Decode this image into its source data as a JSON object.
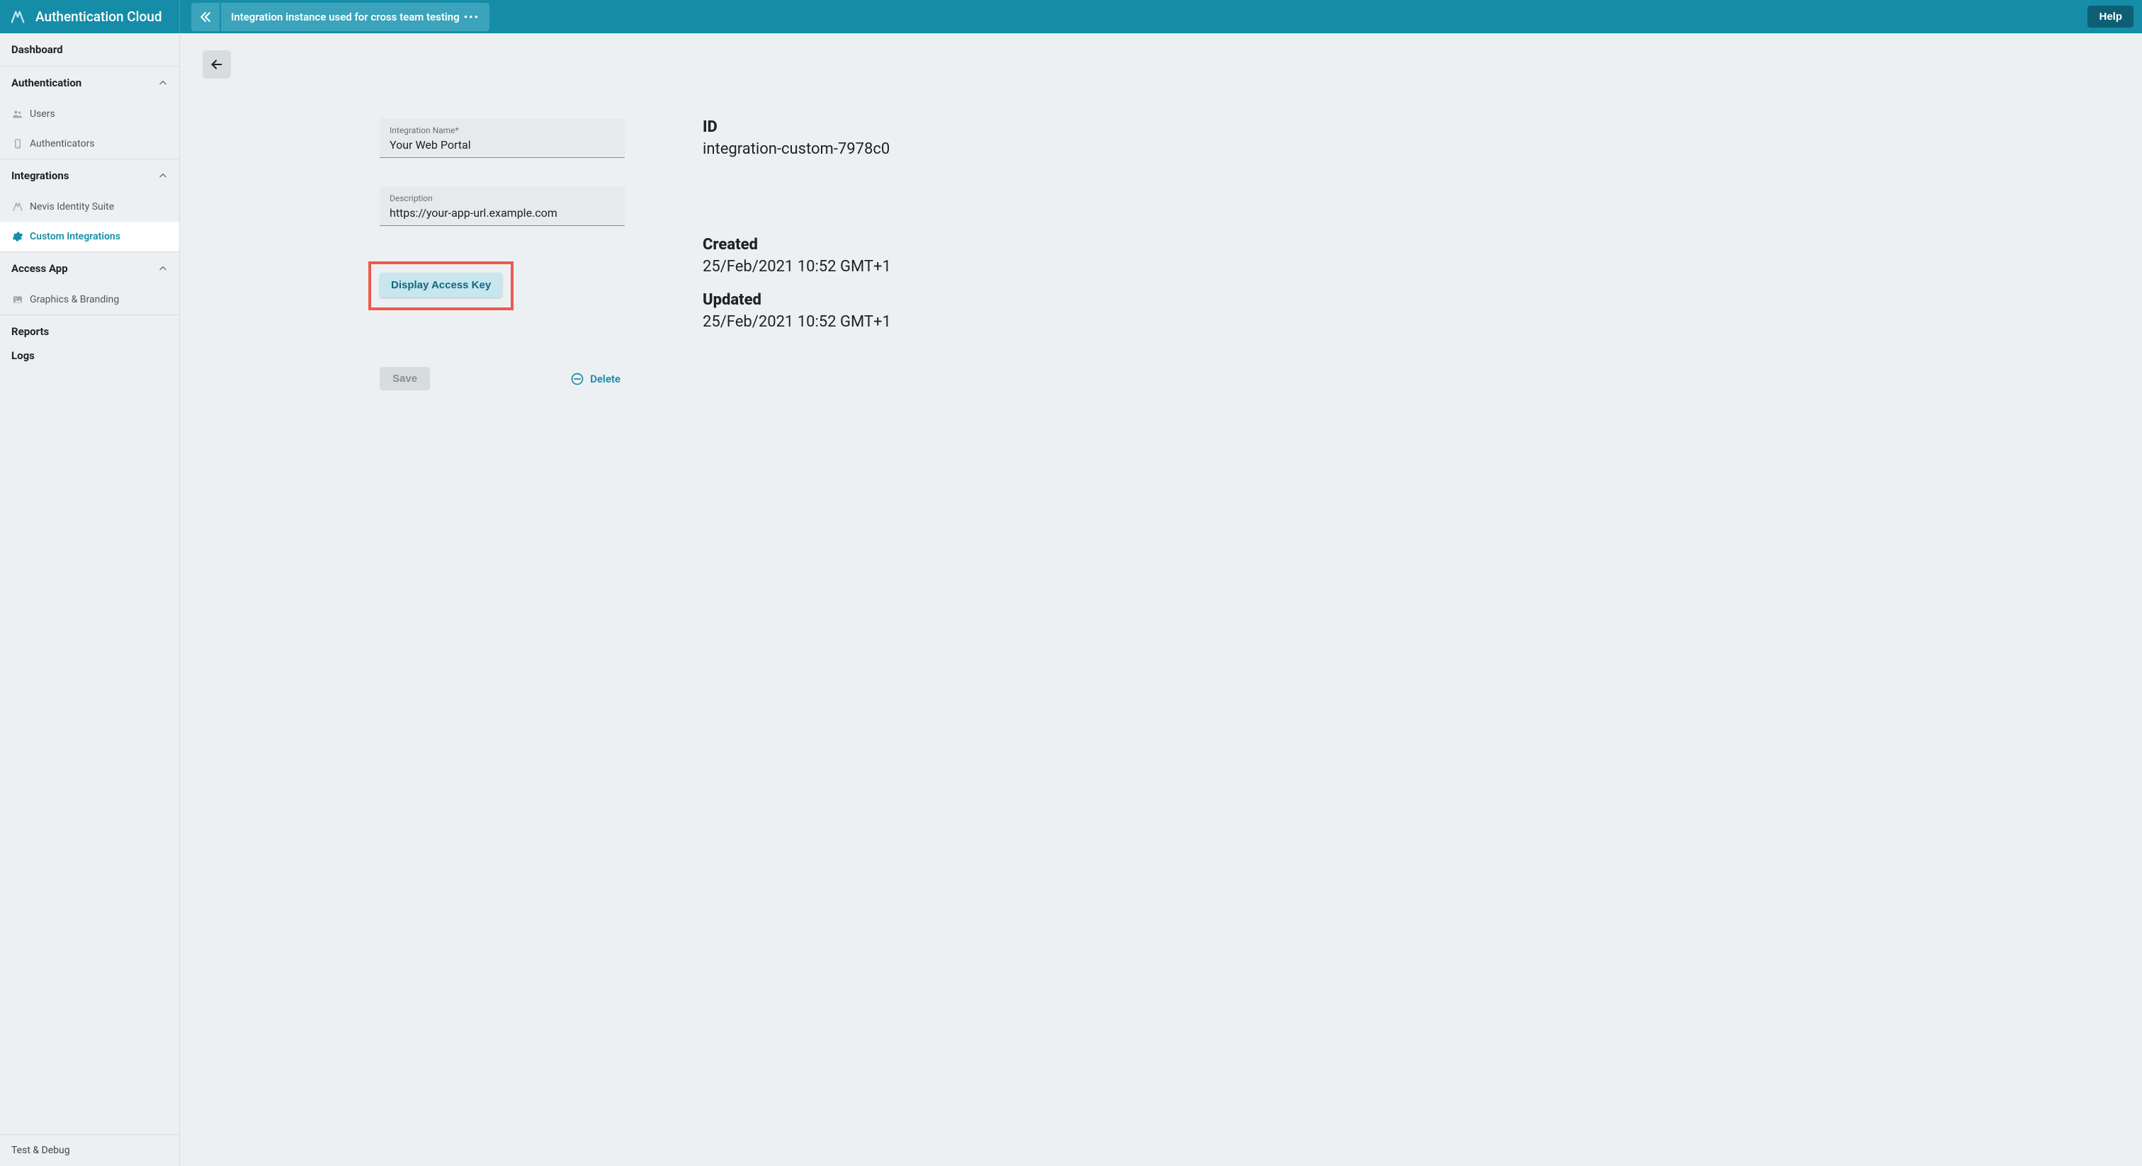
{
  "header": {
    "brand_title": "Authentication Cloud",
    "breadcrumb_label": "Integration instance used for cross team testing",
    "breadcrumb_dots": "•••",
    "help_label": "Help"
  },
  "sidebar": {
    "dashboard": "Dashboard",
    "sections": {
      "authentication": {
        "label": "Authentication",
        "items": [
          {
            "label": "Users"
          },
          {
            "label": "Authenticators"
          }
        ]
      },
      "integrations": {
        "label": "Integrations",
        "items": [
          {
            "label": "Nevis Identity Suite"
          },
          {
            "label": "Custom Integrations",
            "active": true
          }
        ]
      },
      "access_app": {
        "label": "Access App",
        "items": [
          {
            "label": "Graphics & Branding"
          }
        ]
      }
    },
    "reports": "Reports",
    "logs": "Logs",
    "test_debug": "Test & Debug"
  },
  "form": {
    "name_label": "Integration Name*",
    "name_value": "Your Web Portal",
    "description_label": "Description",
    "description_value": "https://your-app-url.example.com",
    "display_access_key_label": "Display Access Key",
    "save_label": "Save",
    "delete_label": "Delete"
  },
  "meta": {
    "id_label": "ID",
    "id_value": "integration-custom-7978c0",
    "created_label": "Created",
    "created_value": "25/Feb/2021 10:52 GMT+1",
    "updated_label": "Updated",
    "updated_value": "25/Feb/2021 10:52 GMT+1"
  }
}
